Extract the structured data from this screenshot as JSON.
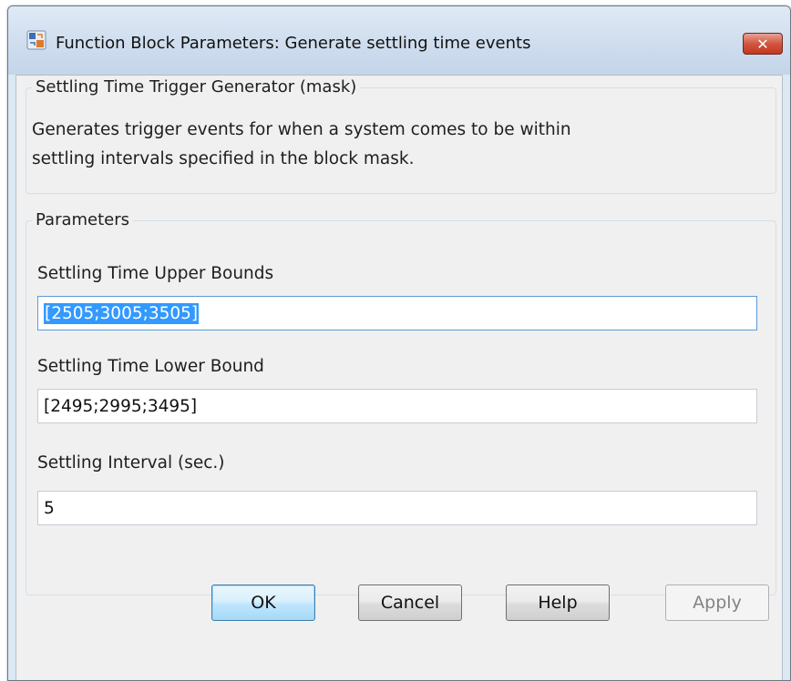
{
  "window": {
    "title": "Function Block Parameters: Generate settling time events",
    "close_label": "✕"
  },
  "mask": {
    "group_title": "Settling Time Trigger Generator (mask)",
    "description_line1": "Generates trigger events for when a system comes to be within",
    "description_line2": "settling intervals specified in the block mask."
  },
  "parameters": {
    "group_title": "Parameters",
    "upper_label": "Settling Time Upper Bounds",
    "upper_value": "[2505;3005;3505]",
    "lower_label": "Settling Time Lower Bound",
    "lower_value": "[2495;2995;3495]",
    "interval_label": "Settling Interval (sec.)",
    "interval_value": "5"
  },
  "buttons": {
    "ok": "OK",
    "cancel": "Cancel",
    "help": "Help",
    "apply": "Apply"
  }
}
